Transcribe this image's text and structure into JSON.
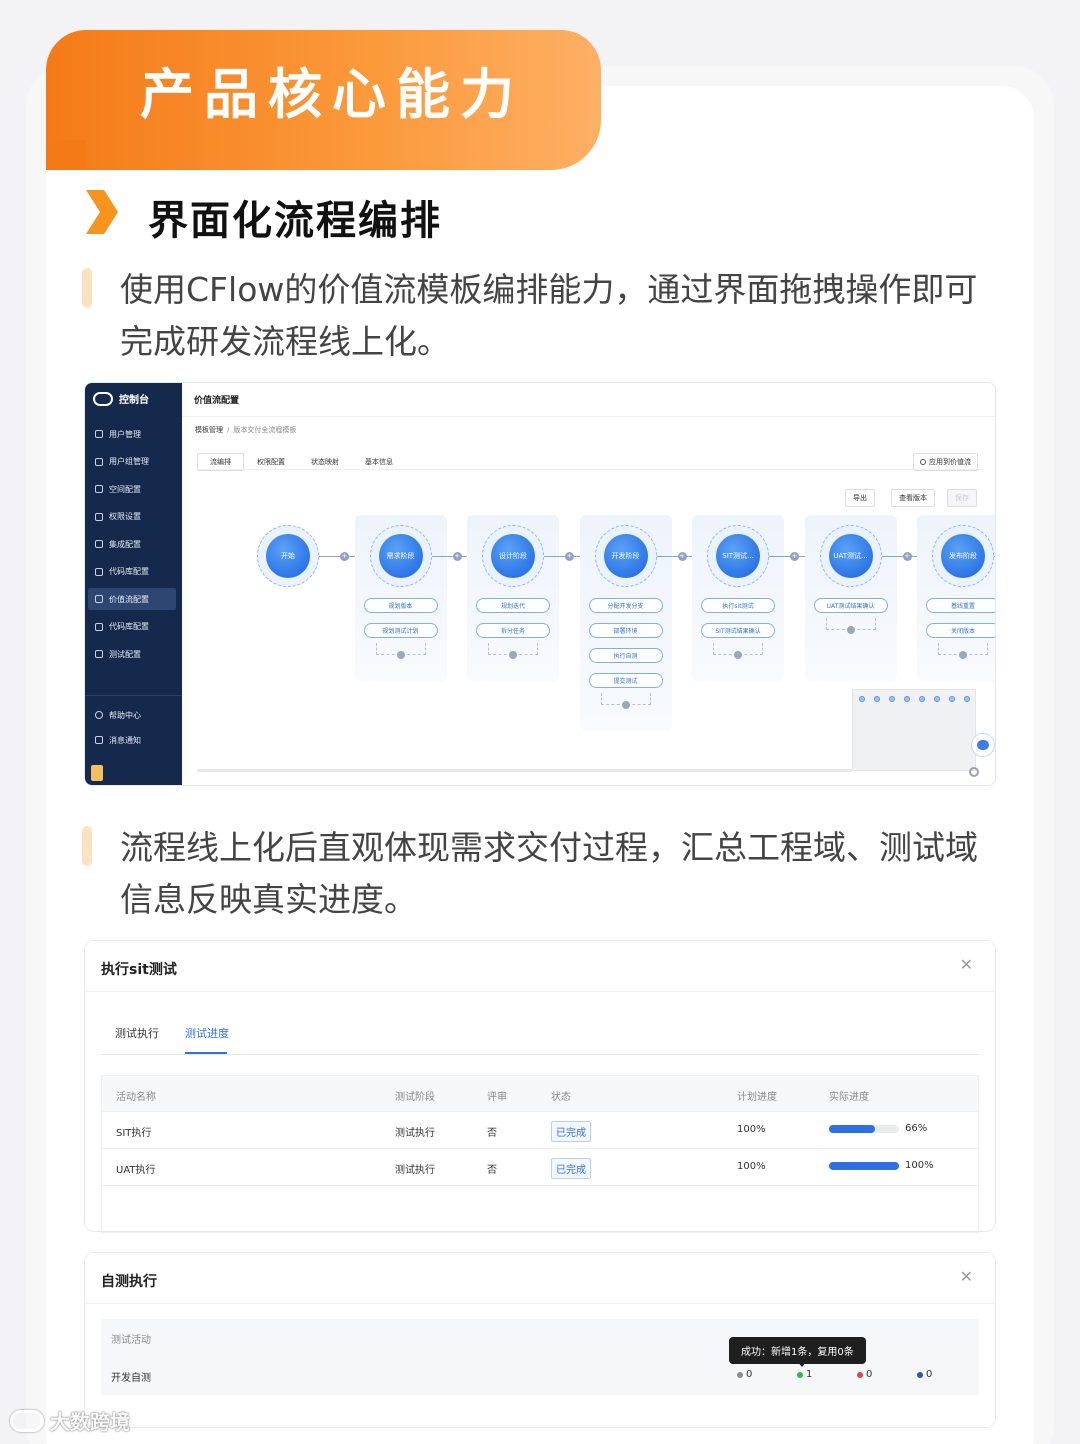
{
  "banner": {
    "title": "产品核心能力"
  },
  "section": {
    "title": "界面化流程编排"
  },
  "para1": "使用CFlow的价值流模板编排能力，通过界面拖拽操作即可完成研发流程线上化。",
  "para2": "流程线上化后直观体现需求交付过程，汇总工程域、测试域信息反映真实进度。",
  "screenshot1": {
    "brand": "控制台",
    "menu": [
      "用户管理",
      "用户组管理",
      "空间配置",
      "权限设置",
      "集成配置",
      "代码库配置",
      "价值流配置",
      "代码库配置",
      "测试配置"
    ],
    "active_menu_index": 6,
    "bottom_menu": [
      "帮助中心",
      "消息通知"
    ],
    "page_title": "价值流配置",
    "breadcrumb": {
      "parent": "模板管理",
      "current": "版本交付全流程模板"
    },
    "tabs": [
      "流编排",
      "权限配置",
      "状态映射",
      "基本信息"
    ],
    "active_tab_index": 0,
    "apply_label": "应用到价值流",
    "buttons": {
      "export": "导出",
      "view_version": "查看版本",
      "save": "保存"
    },
    "stages": [
      {
        "name": "开始",
        "tasks": []
      },
      {
        "name": "需求阶段",
        "tasks": [
          "规划版本",
          "规划测试计划"
        ]
      },
      {
        "name": "设计阶段",
        "tasks": [
          "规划迭代",
          "拆分任务"
        ]
      },
      {
        "name": "开发阶段",
        "tasks": [
          "分配开发分支",
          "部署环境",
          "执行自测",
          "提交测试"
        ]
      },
      {
        "name": "SIT测试...",
        "tasks": [
          "执行sit测试",
          "SIT测试结果确认"
        ]
      },
      {
        "name": "UAT测试...",
        "tasks": [
          "UAT测试结果确认"
        ]
      },
      {
        "name": "发布阶段",
        "tasks": [
          "基线重置",
          "关闭版本"
        ]
      }
    ]
  },
  "panel1": {
    "title": "执行sit测试",
    "tabs": [
      "测试执行",
      "测试进度"
    ],
    "active_tab_index": 1,
    "columns": [
      "活动名称",
      "测试阶段",
      "评审",
      "状态",
      "计划进度",
      "实际进度"
    ],
    "rows": [
      {
        "name": "SIT执行",
        "stage": "测试执行",
        "review": "否",
        "status": "已完成",
        "plan": "100%",
        "actual_label": "66%",
        "actual": 0.66
      },
      {
        "name": "UAT执行",
        "stage": "测试执行",
        "review": "否",
        "status": "已完成",
        "plan": "100%",
        "actual_label": "100%",
        "actual": 1.0
      }
    ]
  },
  "panel2": {
    "title": "自测执行",
    "column": "测试活动",
    "row_name": "开发自测",
    "tooltip": "成功：新增1条，复用0条",
    "counts": [
      {
        "value": "0",
        "color": "#8c8c8c"
      },
      {
        "value": "1",
        "color": "#2fb84f"
      },
      {
        "value": "0",
        "color": "#e8423a"
      },
      {
        "value": "0",
        "color": "#2757b8"
      }
    ]
  },
  "watermark": {
    "text": "大数跨境"
  },
  "colors": {
    "brand_orange": "#f47a17",
    "primary_blue": "#2f6fe4",
    "sidebar": "#15294c"
  }
}
